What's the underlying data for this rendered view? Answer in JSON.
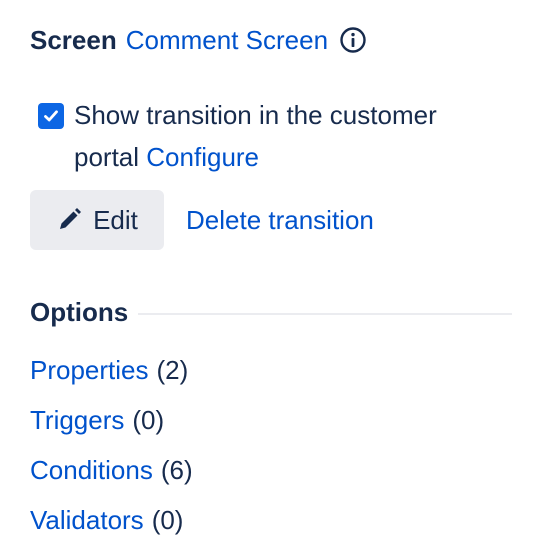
{
  "screen": {
    "label": "Screen",
    "value": "Comment Screen",
    "info_icon": "info-icon"
  },
  "customer_portal": {
    "checked": true,
    "text": "Show transition in the customer portal",
    "configure_label": "Configure"
  },
  "actions": {
    "edit_label": "Edit",
    "edit_icon": "pencil-icon",
    "delete_label": "Delete transition"
  },
  "options": {
    "title": "Options",
    "items": [
      {
        "label": "Properties",
        "count": "(2)"
      },
      {
        "label": "Triggers",
        "count": "(0)"
      },
      {
        "label": "Conditions",
        "count": "(6)"
      },
      {
        "label": "Validators",
        "count": "(0)"
      }
    ]
  },
  "colors": {
    "link": "#0052CC",
    "text": "#172B4D",
    "checkbox": "#0C66E4",
    "button_bg": "#EBECF0"
  }
}
